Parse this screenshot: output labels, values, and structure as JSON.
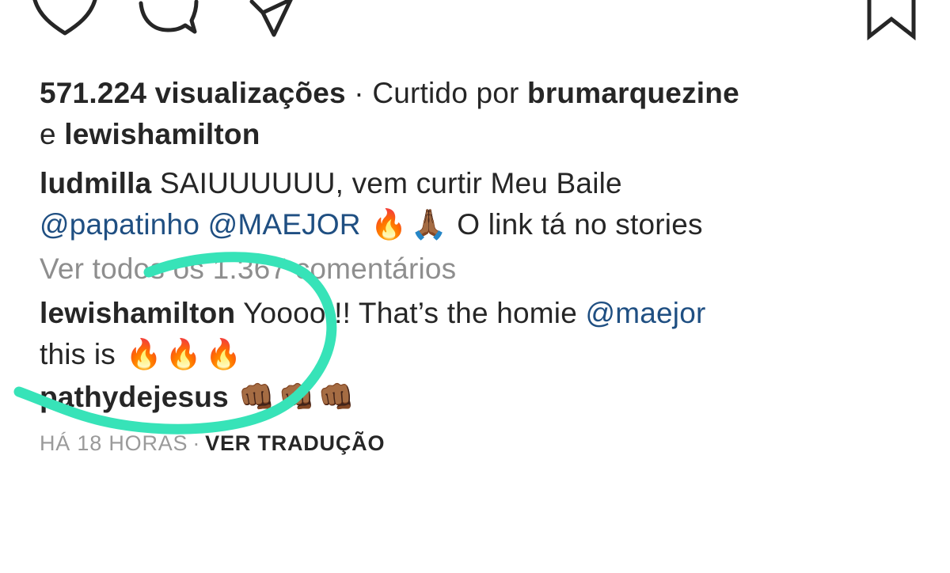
{
  "icons": {
    "like": "heart-icon",
    "comment": "comment-bubble-icon",
    "share": "paper-plane-icon",
    "save": "bookmark-icon"
  },
  "stats": {
    "views": "571.224 visualizações",
    "separator": "·",
    "liked_by_prefix": "Curtido por",
    "liked_by_user1": "brumarquezine",
    "liked_by_joiner": "e",
    "liked_by_user2": "lewishamilton"
  },
  "caption": {
    "username": "ludmilla",
    "text": "SAIUUUUUU, vem curtir Meu Baile",
    "mention1": "@papatinho",
    "mention2": "@MAEJOR",
    "emoji1": "🔥",
    "emoji2": "🙏🏾",
    "text2": "O link tá no stories"
  },
  "view_all_comments": "Ver todos os 1.367 comentários",
  "comments": [
    {
      "username": "lewishamilton",
      "text": "Yoooo!!! That’s the homie",
      "mention": "@maejor",
      "text2": "this is",
      "emojis": [
        "🔥",
        "🔥",
        "🔥"
      ]
    },
    {
      "username": "pathydejesus",
      "emojis": [
        "👊🏾",
        "👊🏾",
        "👊🏾"
      ]
    }
  ],
  "meta": {
    "time": "HÁ 18 HORAS",
    "separator": "·",
    "translate": "VER TRADUÇÃO"
  },
  "colors": {
    "text": "#262626",
    "mention": "#1f4f82",
    "muted": "#8e8e8e",
    "annotation": "#37e3b8"
  }
}
